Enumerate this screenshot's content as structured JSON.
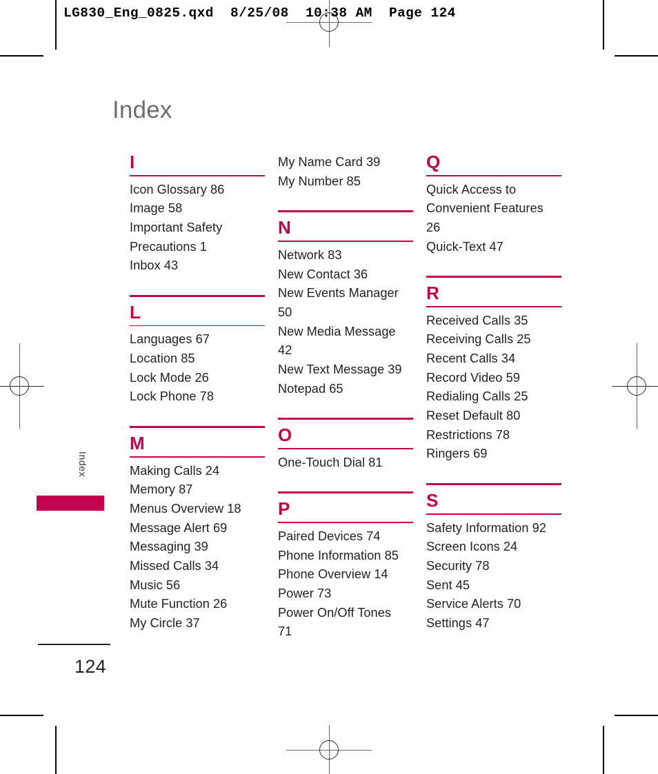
{
  "print_header": "LG830_Eng_0825.qxd  8/25/08  10:38 AM  Page 124",
  "page_title": "Index",
  "side_label": "Index",
  "folio": "124",
  "colors": {
    "accent": "#c4034d",
    "title_gray": "#6e6e6e",
    "body_text": "#231f20"
  },
  "columns": [
    {
      "sections": [
        {
          "letter": "I",
          "top_rule": false,
          "entries": [
            "Icon Glossary 86",
            "Image 58",
            "Important Safety",
            "Precautions 1",
            "Inbox 43"
          ]
        },
        {
          "letter": "L",
          "top_rule": true,
          "entries": [
            "Languages 67",
            "Location 85",
            "Lock Mode 26",
            "Lock Phone 78"
          ]
        },
        {
          "letter": "M",
          "top_rule": true,
          "entries": [
            "Making Calls 24",
            "Memory 87",
            "Menus Overview 18",
            "Message Alert 69",
            "Messaging 39",
            "Missed Calls 34",
            "Music 56",
            "Mute Function 26",
            "My Circle 37"
          ]
        }
      ]
    },
    {
      "sections": [
        {
          "letter": "",
          "top_rule": false,
          "entries": [
            "My Name Card 39",
            "My Number 85"
          ]
        },
        {
          "letter": "N",
          "top_rule": true,
          "entries": [
            "Network 83",
            "New Contact 36",
            "New Events Manager",
            "50",
            "New Media Message",
            "42",
            "New Text Message 39",
            "Notepad 65"
          ]
        },
        {
          "letter": "O",
          "top_rule": true,
          "entries": [
            "One-Touch Dial 81"
          ]
        },
        {
          "letter": "P",
          "top_rule": true,
          "entries": [
            "Paired Devices 74",
            "Phone Information 85",
            "Phone Overview 14",
            "Power 73",
            "Power On/Off Tones",
            "71"
          ]
        }
      ]
    },
    {
      "sections": [
        {
          "letter": "Q",
          "top_rule": false,
          "entries": [
            "Quick Access to",
            "Convenient Features",
            "26",
            "Quick-Text 47"
          ]
        },
        {
          "letter": "R",
          "top_rule": true,
          "entries": [
            "Received Calls 35",
            "Receiving Calls 25",
            "Recent Calls 34",
            "Record Video 59",
            "Redialing Calls 25",
            "Reset Default 80",
            "Restrictions 78",
            "Ringers 69"
          ]
        },
        {
          "letter": "S",
          "top_rule": true,
          "entries": [
            "Safety Information 92",
            "Screen Icons 24",
            "Security 78",
            "Sent 45",
            "Service Alerts 70",
            "Settings 47"
          ]
        }
      ]
    }
  ]
}
